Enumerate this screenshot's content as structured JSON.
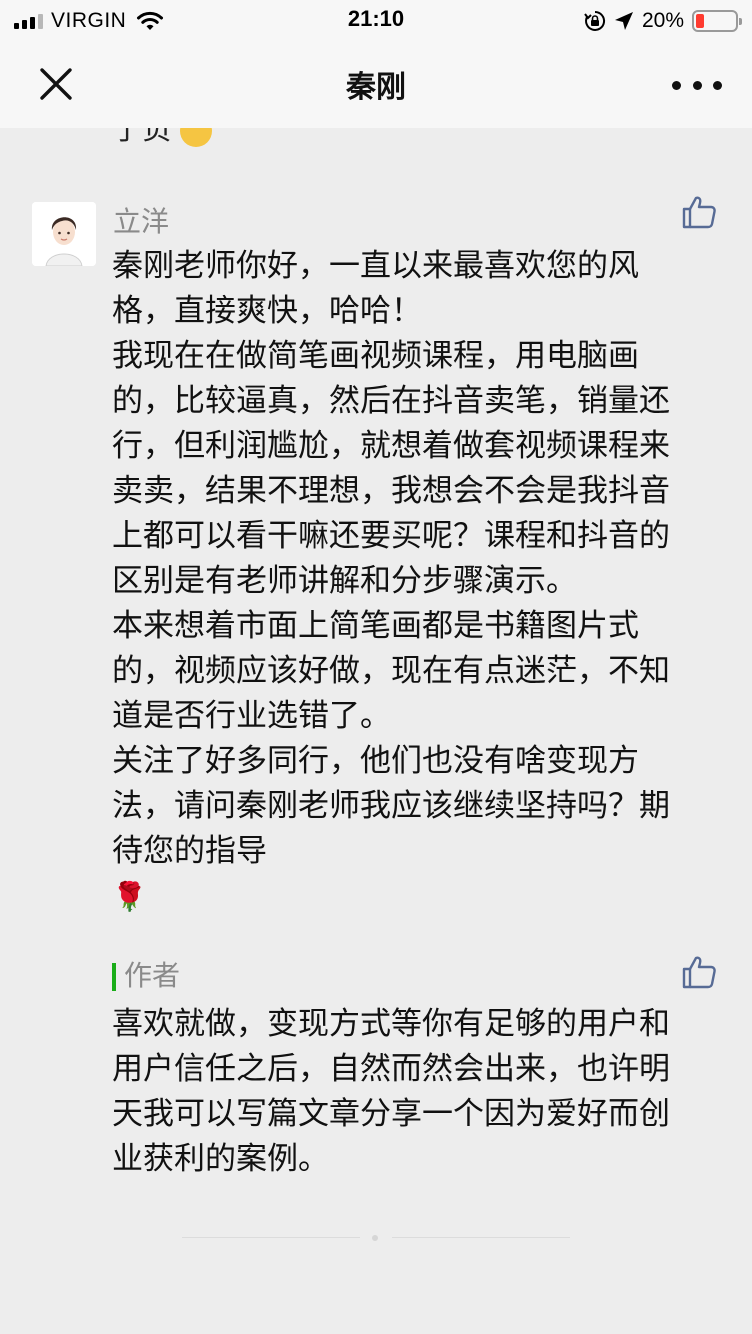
{
  "status_bar": {
    "carrier": "VIRGIN",
    "time": "21:10",
    "battery_percent_text": "20%",
    "battery_level": 0.2,
    "battery_color": "#ff3b30",
    "icons": [
      "signal-icon",
      "wifi-icon",
      "orientation-lock-icon",
      "location-arrow-icon",
      "battery-icon"
    ]
  },
  "nav": {
    "title": "秦刚",
    "close_icon": "close-icon",
    "more_icon": "more-icon"
  },
  "previous_comment_fragment": {
    "text": "了负"
  },
  "comment": {
    "author_name": "立洋",
    "avatar": "avatar",
    "like_icon": "thumbs-up-icon",
    "paragraphs": [
      "秦刚老师你好，一直以来最喜欢您的风格，直接爽快，哈哈！",
      "我现在在做简笔画视频课程，用电脑画的，比较逼真，然后在抖音卖笔，销量还行，但利润尴尬，就想着做套视频课程来卖卖，结果不理想，我想会不会是我抖音上都可以看干嘛还要买呢？课程和抖音的区别是有老师讲解和分步骤演示。",
      "本来想着市面上简笔画都是书籍图片式的，视频应该好做，现在有点迷茫，不知道是否行业选错了。",
      "关注了好多同行，他们也没有啥变现方法，请问秦刚老师我应该继续坚持吗？期待您的指导"
    ],
    "rose_emoji": "🌹"
  },
  "author_reply": {
    "label": "作者",
    "accent_color": "#1aad19",
    "like_icon": "thumbs-up-icon",
    "text": "喜欢就做，变现方式等你有足够的用户和用户信任之后，自然而然会出来，也许明天我可以写篇文章分享一个因为爱好而创业获利的案例。"
  }
}
